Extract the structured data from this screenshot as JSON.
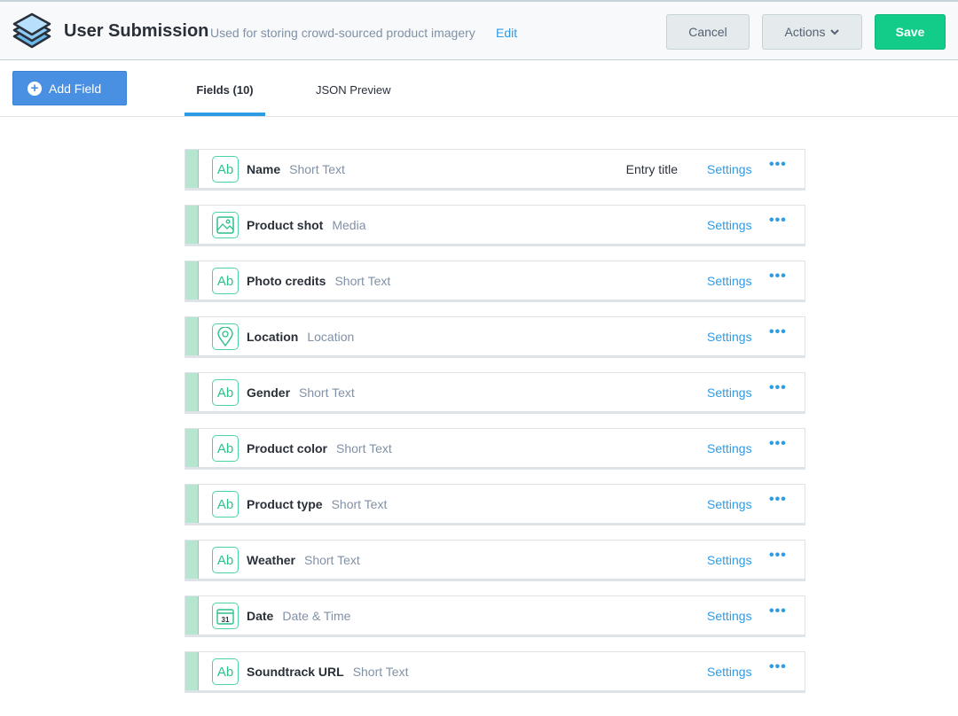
{
  "header": {
    "title": "User Submission",
    "description": "Used for storing crowd-sourced product imagery",
    "edit": "Edit",
    "cancel": "Cancel",
    "actions": "Actions",
    "save": "Save"
  },
  "toolbar": {
    "add_field": "Add Field"
  },
  "tabs": [
    {
      "label": "Fields (10)",
      "active": true
    },
    {
      "label": "JSON Preview",
      "active": false
    }
  ],
  "fields": [
    {
      "name": "Name",
      "type": "Short Text",
      "icon": "text-icon",
      "badge": "Entry title"
    },
    {
      "name": "Product shot",
      "type": "Media",
      "icon": "image-icon"
    },
    {
      "name": "Photo credits",
      "type": "Short Text",
      "icon": "text-icon"
    },
    {
      "name": "Location",
      "type": "Location",
      "icon": "location-icon"
    },
    {
      "name": "Gender",
      "type": "Short Text",
      "icon": "text-icon"
    },
    {
      "name": "Product color",
      "type": "Short Text",
      "icon": "text-icon"
    },
    {
      "name": "Product type",
      "type": "Short Text",
      "icon": "text-icon"
    },
    {
      "name": "Weather",
      "type": "Short Text",
      "icon": "text-icon"
    },
    {
      "name": "Date",
      "type": "Date & Time",
      "icon": "calendar-icon"
    },
    {
      "name": "Soundtrack URL",
      "type": "Short Text",
      "icon": "text-icon"
    }
  ],
  "labels": {
    "settings": "Settings",
    "more": "•••",
    "ab": "Ab",
    "cal": "31"
  }
}
